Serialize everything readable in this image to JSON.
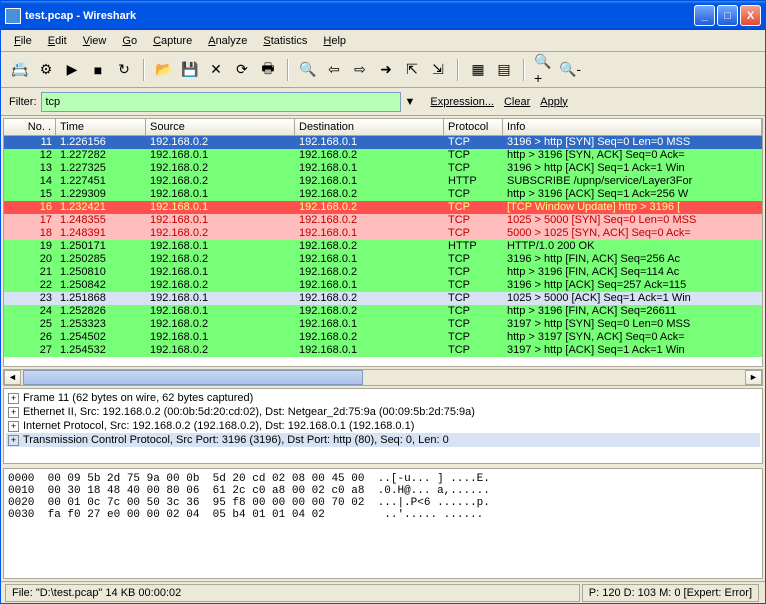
{
  "title": "test.pcap - Wireshark",
  "menus": {
    "file": "File",
    "edit": "Edit",
    "view": "View",
    "go": "Go",
    "capture": "Capture",
    "analyze": "Analyze",
    "statistics": "Statistics",
    "help": "Help"
  },
  "filter": {
    "label": "Filter:",
    "value": "tcp",
    "expression": "Expression...",
    "clear": "Clear",
    "apply": "Apply"
  },
  "columns": {
    "no": "No. .",
    "time": "Time",
    "source": "Source",
    "destination": "Destination",
    "protocol": "Protocol",
    "info": "Info"
  },
  "packets": [
    {
      "no": "11",
      "time": "1.226156",
      "src": "192.168.0.2",
      "dst": "192.168.0.1",
      "proto": "TCP",
      "info": "3196 > http [SYN] Seq=0 Len=0 MSS",
      "bg": "bg-selected"
    },
    {
      "no": "12",
      "time": "1.227282",
      "src": "192.168.0.1",
      "dst": "192.168.0.2",
      "proto": "TCP",
      "info": "http > 3196 [SYN, ACK] Seq=0 Ack=",
      "bg": "bg-green"
    },
    {
      "no": "13",
      "time": "1.227325",
      "src": "192.168.0.2",
      "dst": "192.168.0.1",
      "proto": "TCP",
      "info": "3196 > http [ACK] Seq=1 Ack=1 Win",
      "bg": "bg-green"
    },
    {
      "no": "14",
      "time": "1.227451",
      "src": "192.168.0.2",
      "dst": "192.168.0.1",
      "proto": "HTTP",
      "info": "SUBSCRIBE /upnp/service/Layer3For",
      "bg": "bg-green"
    },
    {
      "no": "15",
      "time": "1.229309",
      "src": "192.168.0.1",
      "dst": "192.168.0.2",
      "proto": "TCP",
      "info": "http > 3196 [ACK] Seq=1 Ack=256 W",
      "bg": "bg-green"
    },
    {
      "no": "16",
      "time": "1.232421",
      "src": "192.168.0.1",
      "dst": "192.168.0.2",
      "proto": "TCP",
      "info": "[TCP Window Update] http > 3196 [",
      "bg": "bg-red"
    },
    {
      "no": "17",
      "time": "1.248355",
      "src": "192.168.0.1",
      "dst": "192.168.0.2",
      "proto": "TCP",
      "info": "1025 > 5000 [SYN] Seq=0 Len=0 MSS",
      "bg": "bg-redlight"
    },
    {
      "no": "18",
      "time": "1.248391",
      "src": "192.168.0.2",
      "dst": "192.168.0.1",
      "proto": "TCP",
      "info": "5000 > 1025 [SYN, ACK] Seq=0 Ack=",
      "bg": "bg-redlight"
    },
    {
      "no": "19",
      "time": "1.250171",
      "src": "192.168.0.1",
      "dst": "192.168.0.2",
      "proto": "HTTP",
      "info": "HTTP/1.0 200 OK",
      "bg": "bg-green"
    },
    {
      "no": "20",
      "time": "1.250285",
      "src": "192.168.0.2",
      "dst": "192.168.0.1",
      "proto": "TCP",
      "info": "3196 > http [FIN, ACK] Seq=256 Ac",
      "bg": "bg-green"
    },
    {
      "no": "21",
      "time": "1.250810",
      "src": "192.168.0.1",
      "dst": "192.168.0.2",
      "proto": "TCP",
      "info": "http > 3196 [FIN, ACK] Seq=114 Ac",
      "bg": "bg-green"
    },
    {
      "no": "22",
      "time": "1.250842",
      "src": "192.168.0.2",
      "dst": "192.168.0.1",
      "proto": "TCP",
      "info": "3196 > http [ACK] Seq=257 Ack=115",
      "bg": "bg-green"
    },
    {
      "no": "23",
      "time": "1.251868",
      "src": "192.168.0.1",
      "dst": "192.168.0.2",
      "proto": "TCP",
      "info": "1025 > 5000 [ACK] Seq=1 Ack=1 Win",
      "bg": "bg-bluelight"
    },
    {
      "no": "24",
      "time": "1.252826",
      "src": "192.168.0.1",
      "dst": "192.168.0.2",
      "proto": "TCP",
      "info": "http > 3196 [FIN, ACK] Seq=26611 ",
      "bg": "bg-green"
    },
    {
      "no": "25",
      "time": "1.253323",
      "src": "192.168.0.2",
      "dst": "192.168.0.1",
      "proto": "TCP",
      "info": "3197 > http [SYN] Seq=0 Len=0 MSS",
      "bg": "bg-green"
    },
    {
      "no": "26",
      "time": "1.254502",
      "src": "192.168.0.1",
      "dst": "192.168.0.2",
      "proto": "TCP",
      "info": "http > 3197 [SYN, ACK] Seq=0 Ack=",
      "bg": "bg-green"
    },
    {
      "no": "27",
      "time": "1.254532",
      "src": "192.168.0.2",
      "dst": "192.168.0.1",
      "proto": "TCP",
      "info": "3197 > http [ACK] Seq=1 Ack=1 Win",
      "bg": "bg-green"
    }
  ],
  "tree": {
    "frame": "Frame 11 (62 bytes on wire, 62 bytes captured)",
    "eth": "Ethernet II, Src: 192.168.0.2 (00:0b:5d:20:cd:02), Dst: Netgear_2d:75:9a (00:09:5b:2d:75:9a)",
    "ip": "Internet Protocol, Src: 192.168.0.2 (192.168.0.2), Dst: 192.168.0.1 (192.168.0.1)",
    "tcp": "Transmission Control Protocol, Src Port: 3196 (3196), Dst Port: http (80), Seq: 0, Len: 0"
  },
  "hex": "0000  00 09 5b 2d 75 9a 00 0b  5d 20 cd 02 08 00 45 00  ..[-u... ] ....E.\n0010  00 30 18 48 40 00 80 06  61 2c c0 a8 00 02 c0 a8  .0.H@... a,......\n0020  00 01 0c 7c 00 50 3c 36  95 f8 00 00 00 00 70 02  ...|.P<6 ......p.\n0030  fa f0 27 e0 00 00 02 04  05 b4 01 01 04 02         ..'..... ......",
  "status": {
    "file": "File: \"D:\\test.pcap\" 14 KB 00:00:02",
    "stats": "P: 120 D: 103 M: 0 [Expert: Error]"
  }
}
